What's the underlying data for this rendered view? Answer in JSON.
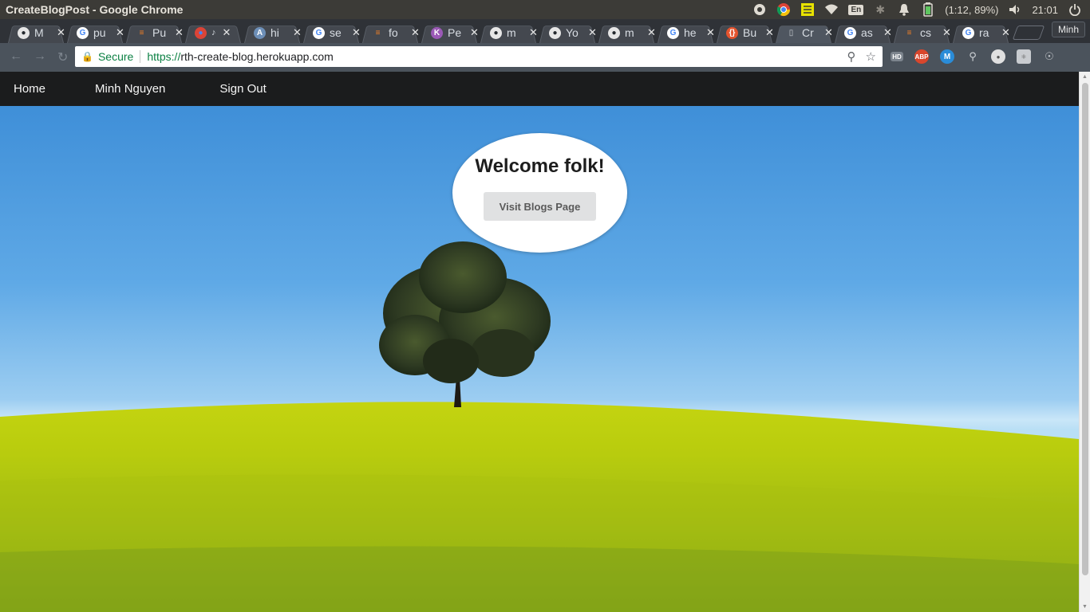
{
  "system": {
    "window_title": "CreateBlogPost - Google Chrome",
    "keyboard_layout": "En",
    "battery": "(1:12, 89%)",
    "clock": "21:01"
  },
  "tabs": [
    {
      "title": "M",
      "favicon": "github-icon"
    },
    {
      "title": "pu",
      "favicon": "google-icon"
    },
    {
      "title": "Pu",
      "favicon": "stackoverflow-icon"
    },
    {
      "title": "",
      "favicon": "chrome-icon",
      "audio": true
    },
    {
      "title": "hi",
      "favicon": "a-icon"
    },
    {
      "title": "se",
      "favicon": "google-icon"
    },
    {
      "title": "fo",
      "favicon": "stackoverflow-icon"
    },
    {
      "title": "Pe",
      "favicon": "k-icon"
    },
    {
      "title": "m",
      "favicon": "github-icon"
    },
    {
      "title": "Yo",
      "favicon": "github-icon"
    },
    {
      "title": "m",
      "favicon": "github-icon"
    },
    {
      "title": "he",
      "favicon": "google-icon"
    },
    {
      "title": "Bu",
      "favicon": "code-icon"
    },
    {
      "title": "Cr",
      "favicon": "page-icon",
      "active": true
    },
    {
      "title": "as",
      "favicon": "google-icon"
    },
    {
      "title": "cs",
      "favicon": "stackoverflow-icon"
    },
    {
      "title": "ra",
      "favicon": "google-icon"
    }
  ],
  "profile_name": "Minh",
  "omnibox": {
    "secure_label": "Secure",
    "scheme": "https://",
    "host": "rth-create-blog.herokuapp.com"
  },
  "navbar": {
    "home": "Home",
    "user": "Minh Nguyen",
    "signout": "Sign Out"
  },
  "hero": {
    "heading": "Welcome folk!",
    "button": "Visit Blogs Page"
  }
}
